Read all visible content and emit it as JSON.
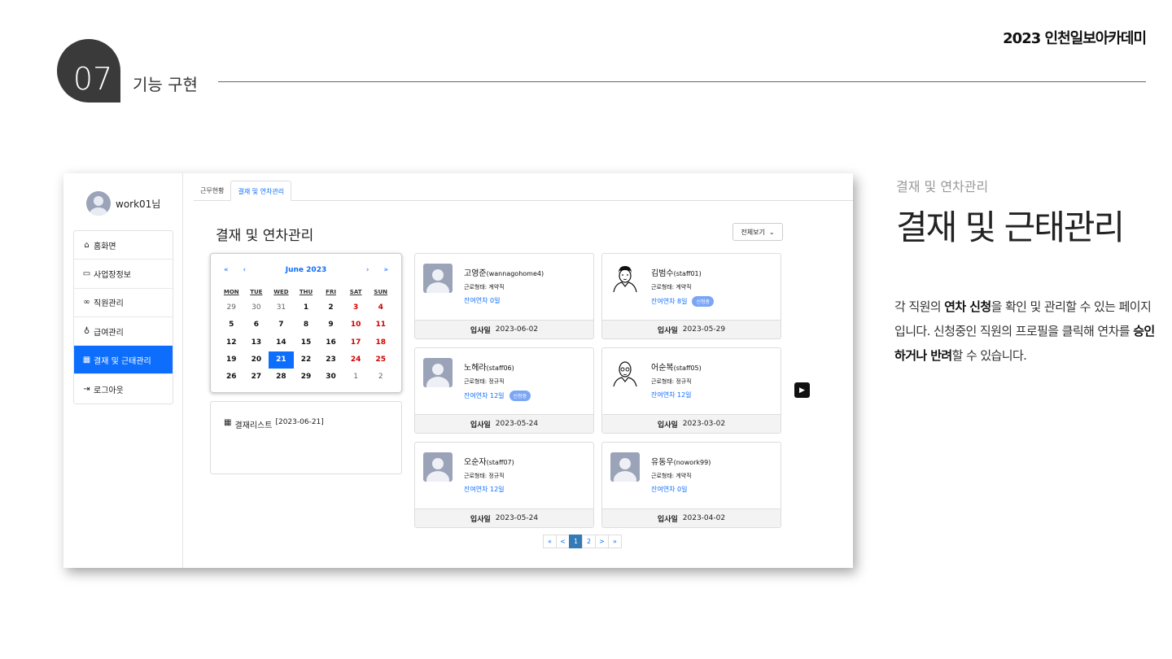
{
  "header": {
    "brand": "2023 인천일보아카데미",
    "section_number": "07",
    "section_title": "기능 구현"
  },
  "sidebar": {
    "user_name": "work01님",
    "items": [
      {
        "label": "홈화면",
        "icon": "home-icon"
      },
      {
        "label": "사업장정보",
        "icon": "briefcase-icon"
      },
      {
        "label": "직원관리",
        "icon": "people-icon"
      },
      {
        "label": "급여관리",
        "icon": "money-bag-icon"
      },
      {
        "label": "결재 및 근태관리",
        "icon": "calendar-icon",
        "active": true
      },
      {
        "label": "로그아웃",
        "icon": "logout-icon"
      }
    ]
  },
  "tabs": [
    {
      "label": "근무현황"
    },
    {
      "label": "결재 및 연차관리",
      "active": true
    }
  ],
  "main": {
    "page_title": "결재 및 연차관리",
    "view_all_label": "전체보기"
  },
  "calendar": {
    "month_label": "June 2023",
    "nav": {
      "prev_year": "«",
      "prev": "‹",
      "next": "›",
      "next_year": "»"
    },
    "weekdays": [
      "MON",
      "TUE",
      "WED",
      "THU",
      "FRI",
      "SAT",
      "SUN"
    ],
    "weeks": [
      [
        "29",
        "30",
        "31",
        "1",
        "2",
        "3",
        "4"
      ],
      [
        "5",
        "6",
        "7",
        "8",
        "9",
        "10",
        "11"
      ],
      [
        "12",
        "13",
        "14",
        "15",
        "16",
        "17",
        "18"
      ],
      [
        "19",
        "20",
        "21",
        "22",
        "23",
        "24",
        "25"
      ],
      [
        "26",
        "27",
        "28",
        "29",
        "30",
        "1",
        "2"
      ]
    ],
    "selected_day": "21"
  },
  "approval": {
    "label": "결재리스트",
    "date": "[2023-06-21]"
  },
  "employees": [
    {
      "name": "고영준",
      "id": "(wannagohome4)",
      "type": "근로형태: 계약직",
      "leave": "잔여연차 0일",
      "badge": "",
      "join_label": "입사일",
      "join_date": "2023-06-02",
      "photo": "default"
    },
    {
      "name": "김범수",
      "id": "(staff01)",
      "type": "근로형태: 계약직",
      "leave": "잔여연차 8일",
      "badge": "신청중",
      "join_label": "입사일",
      "join_date": "2023-05-29",
      "photo": "drawn-a"
    },
    {
      "name": "노헤라",
      "id": "(staff06)",
      "type": "근로형태: 정규직",
      "leave": "잔여연차 12일",
      "badge": "신청중",
      "join_label": "입사일",
      "join_date": "2023-05-24",
      "photo": "default"
    },
    {
      "name": "어순복",
      "id": "(staff05)",
      "type": "근로형태: 정규직",
      "leave": "잔여연차 12일",
      "badge": "",
      "join_label": "입사일",
      "join_date": "2023-03-02",
      "photo": "drawn-b"
    },
    {
      "name": "오순자",
      "id": "(staff07)",
      "type": "근로형태: 정규직",
      "leave": "잔여연차 12일",
      "badge": "",
      "join_label": "입사일",
      "join_date": "2023-05-24",
      "photo": "default"
    },
    {
      "name": "유동우",
      "id": "(nowork99)",
      "type": "근로형태: 계약직",
      "leave": "잔여연차 0일",
      "badge": "",
      "join_label": "입사일",
      "join_date": "2023-04-02",
      "photo": "default"
    }
  ],
  "pagination": [
    "«",
    "<",
    "1",
    "2",
    ">",
    "»"
  ],
  "pagination_active": "1",
  "description": {
    "subtitle": "결재 및 연차관리",
    "title": "결재 및 근태관리",
    "p1": "각 직원의 ",
    "b1": "연차 신청",
    "p2": "을 확인 및 관리할 수 있는 페이지입니다. 신청중인 직원의 프로필을 클릭해 연차를 ",
    "b2": "승인하거나 반려",
    "p3": "할 수 있습니다."
  },
  "colors": {
    "accent": "#0d6efd",
    "weekend": "#d10000",
    "badge": "#7aa6f5"
  }
}
